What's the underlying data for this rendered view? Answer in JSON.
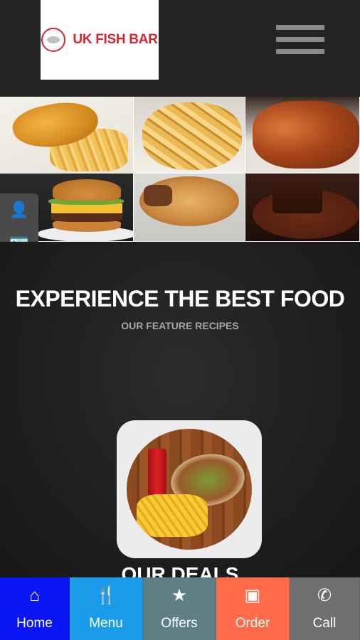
{
  "header": {
    "logo_text": "UK FISH BAR",
    "menu_icon": "hamburger-icon"
  },
  "gallery": {
    "items": [
      "fish-and-chips",
      "chips",
      "chicken-wings",
      "burger",
      "pie",
      "chocolate-cake"
    ]
  },
  "side_widget": {
    "icons": [
      "user-icon",
      "contact-card-icon"
    ]
  },
  "hero": {
    "title": "EXPERIENCE THE BEST FOOD",
    "subtitle": "OUR FEATURE RECIPES",
    "deals_title": "OUR DEALS"
  },
  "bottom_nav": [
    {
      "label": "Home",
      "icon": "home-icon",
      "glyph": "⌂",
      "color": "#0a16f5"
    },
    {
      "label": "Menu",
      "icon": "cutlery-icon",
      "glyph": "🍴",
      "color": "#1b9cea"
    },
    {
      "label": "Offers",
      "icon": "star-icon",
      "glyph": "★",
      "color": "#5f7f86"
    },
    {
      "label": "Order",
      "icon": "money-icon",
      "glyph": "▣",
      "color": "#ff6b4a"
    },
    {
      "label": "Call",
      "icon": "phone-icon",
      "glyph": "✆",
      "color": "#6f6f6f"
    }
  ]
}
